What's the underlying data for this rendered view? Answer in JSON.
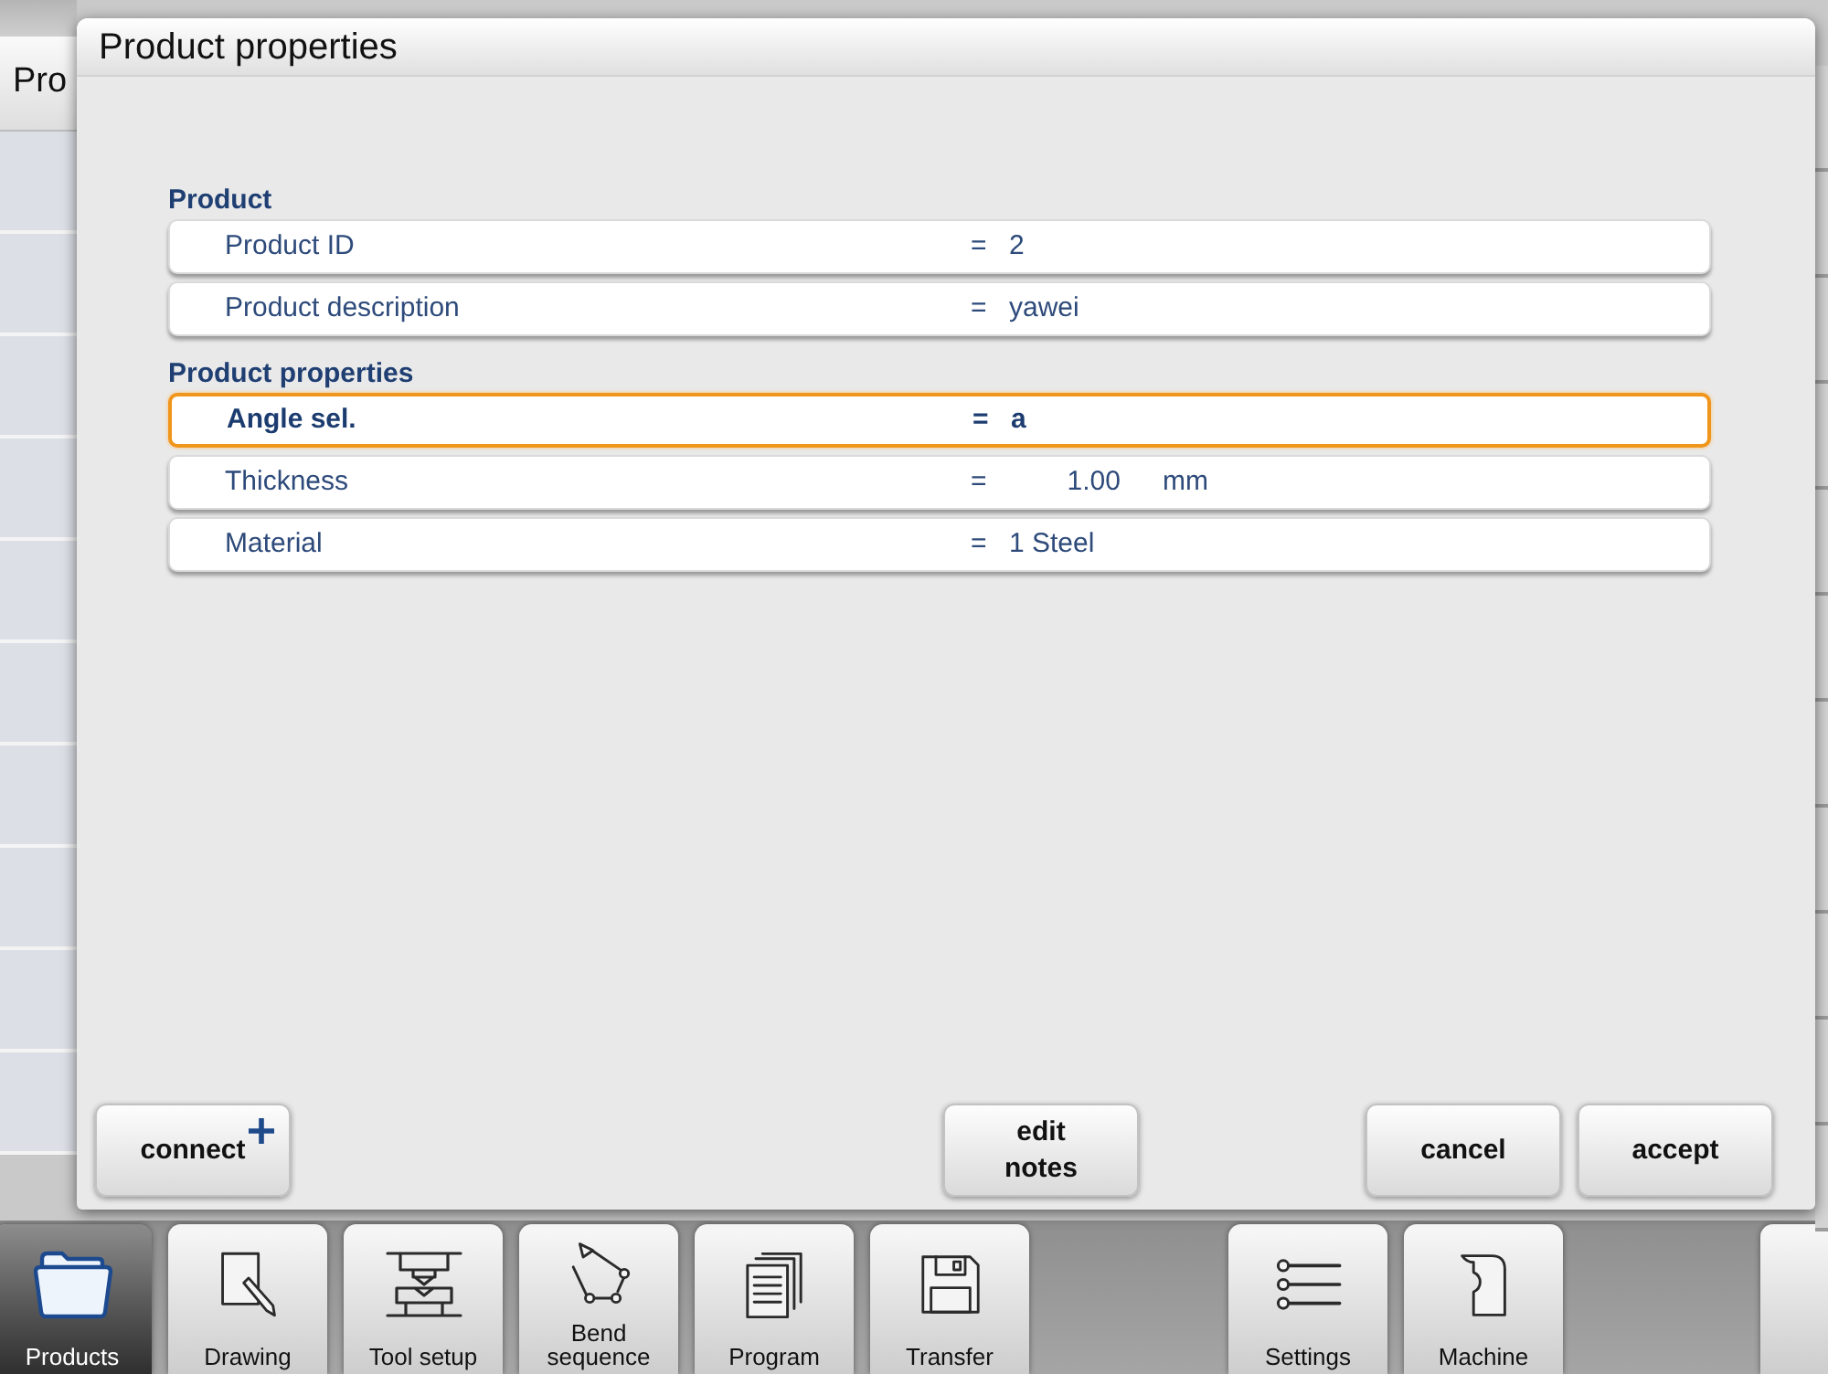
{
  "background_page": {
    "title": "Pro"
  },
  "dialog": {
    "title": "Product properties",
    "groups": [
      {
        "label": "Product",
        "rows": [
          {
            "label": "Product ID",
            "sign": "=",
            "value": "2",
            "kind": "text",
            "selected": false
          },
          {
            "label": "Product description",
            "sign": "=",
            "value": "yawei",
            "kind": "text",
            "selected": false
          }
        ]
      },
      {
        "label": "Product properties",
        "rows": [
          {
            "label": "Angle sel.",
            "sign": "=",
            "value": "a",
            "kind": "text",
            "selected": true
          },
          {
            "label": "Thickness",
            "sign": "=",
            "value": "1.00",
            "unit": "mm",
            "kind": "number",
            "selected": false
          },
          {
            "label": "Material",
            "sign": "=",
            "value": "1 Steel",
            "kind": "text",
            "selected": false
          }
        ]
      }
    ],
    "footer": {
      "left": [
        {
          "label": "connect",
          "kind": "add"
        }
      ],
      "center": [
        {
          "label": "edit notes",
          "kind": "plain"
        }
      ],
      "right": [
        {
          "label": "cancel",
          "kind": "plain"
        },
        {
          "label": "accept",
          "kind": "plain"
        }
      ]
    }
  },
  "toolbar": {
    "left": [
      {
        "label": "Products",
        "kind": "products",
        "selected": true
      },
      {
        "label": "Drawing",
        "kind": "drawing",
        "selected": false
      },
      {
        "label": "Tool setup",
        "kind": "tools",
        "selected": false
      },
      {
        "label": "Bend sequence",
        "kind": "sequence",
        "selected": false
      },
      {
        "label": "Program",
        "kind": "program",
        "selected": false
      },
      {
        "label": "Transfer",
        "kind": "transfer",
        "selected": false
      }
    ],
    "right": [
      {
        "label": "Settings",
        "kind": "settings",
        "selected": false
      },
      {
        "label": "Machine",
        "kind": "machine",
        "selected": false
      }
    ]
  }
}
